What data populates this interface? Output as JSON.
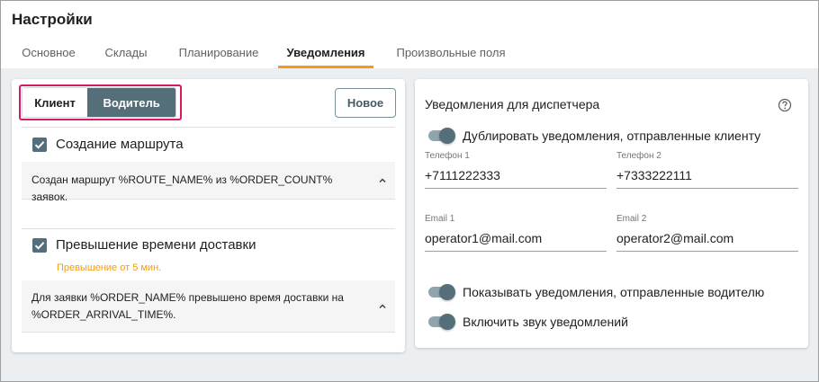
{
  "header": {
    "title": "Настройки",
    "tabs": [
      {
        "label": "Основное",
        "active": false
      },
      {
        "label": "Склады",
        "active": false
      },
      {
        "label": "Планирование",
        "active": false
      },
      {
        "label": "Уведомления",
        "active": true
      },
      {
        "label": "Произвольные поля",
        "active": false
      }
    ],
    "accent_color": "#f39c12"
  },
  "left_panel": {
    "segments": {
      "client": "Клиент",
      "driver": "Водитель",
      "selected": "driver"
    },
    "new_button": "Новое",
    "notifications": [
      {
        "checked": true,
        "title": "Создание маршрута",
        "note": "",
        "template": "Создан маршрут %ROUTE_NAME% из %ORDER_COUNT% заявок."
      },
      {
        "checked": true,
        "title": "Превышение времени доставки",
        "note": "Превышение от 5 мин.",
        "template": "Для заявки %ORDER_NAME% превышено время доставки на %ORDER_ARRIVAL_TIME%."
      }
    ]
  },
  "right_panel": {
    "title": "Уведомления для диспетчера",
    "help_icon": "question-circle-icon",
    "duplicate_toggle": {
      "label": "Дублировать уведомления, отправленные клиенту",
      "on": true
    },
    "phone1": {
      "label": "Телефон 1",
      "value": "+7111222333"
    },
    "phone2": {
      "label": "Телефон 2",
      "value": "+7333222111"
    },
    "email1": {
      "label": "Email 1",
      "value": "operator1@mail.com"
    },
    "email2": {
      "label": "Email 2",
      "value": "operator2@mail.com"
    },
    "show_driver_toggle": {
      "label": "Показывать уведомления, отправленные водителю",
      "on": true
    },
    "sound_toggle": {
      "label": "Включить звук уведомлений",
      "on": true
    }
  }
}
